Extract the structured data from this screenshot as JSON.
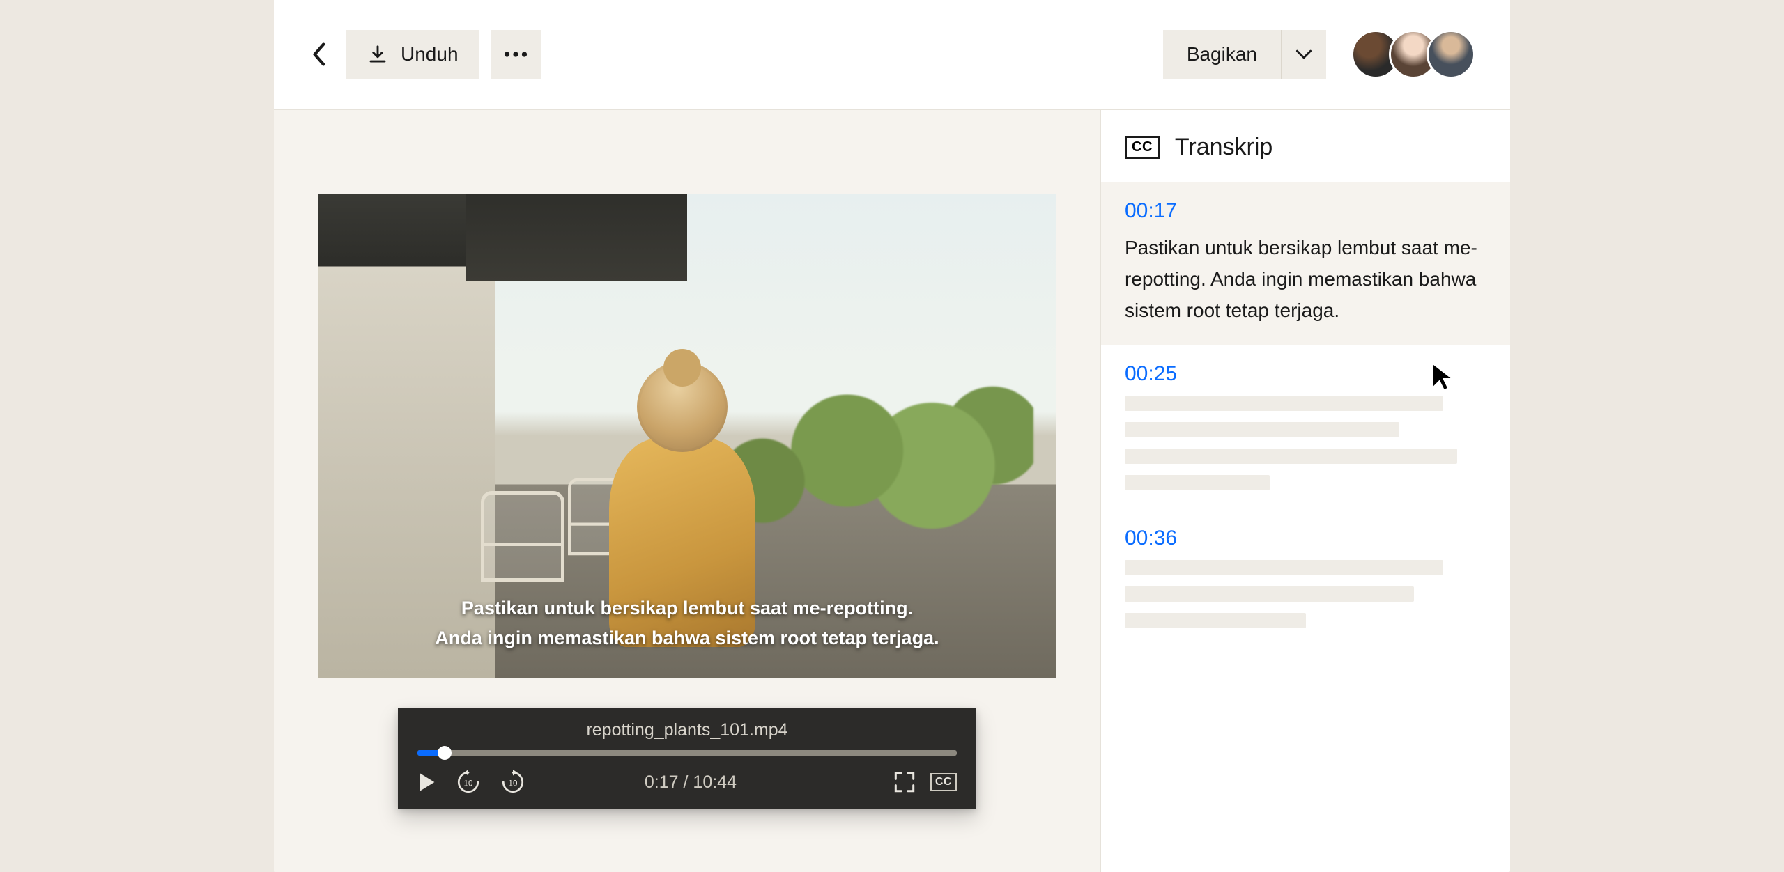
{
  "header": {
    "download_label": "Unduh",
    "share_label": "Bagikan"
  },
  "video": {
    "caption_line1": "Pastikan untuk bersikap lembut saat me-repotting.",
    "caption_line2": "Anda ingin memastikan bahwa sistem root tetap terjaga."
  },
  "player": {
    "filename": "repotting_plants_101.mp4",
    "current_time": "0:17",
    "duration": "10:44",
    "progress_percent": 5
  },
  "transcript": {
    "title": "Transkrip",
    "cc_label": "CC",
    "segments": [
      {
        "time": "00:17",
        "text": "Pastikan untuk bersikap lembut saat me-repotting. Anda ingin memastikan bahwa sistem root tetap terjaga.",
        "active": true
      },
      {
        "time": "00:25",
        "text": null
      },
      {
        "time": "00:36",
        "text": null
      }
    ]
  },
  "colors": {
    "accent": "#0a6cff",
    "surface": "#f6f3ee",
    "button_bg": "#efece6"
  }
}
